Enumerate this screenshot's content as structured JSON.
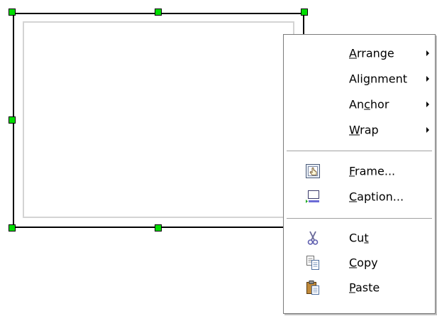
{
  "menu": {
    "items": [
      {
        "id": "arrange",
        "pre": "",
        "accel": "A",
        "post": "rrange",
        "submenu": true
      },
      {
        "id": "alignment",
        "pre": "Ali",
        "accel": "g",
        "post": "nment",
        "submenu": true
      },
      {
        "id": "anchor",
        "pre": "An",
        "accel": "c",
        "post": "hor",
        "submenu": true
      },
      {
        "id": "wrap",
        "pre": "",
        "accel": "W",
        "post": "rap",
        "submenu": true
      },
      {
        "id": "frame",
        "pre": "",
        "accel": "F",
        "post": "rame...",
        "submenu": false,
        "icon": "frame-properties-icon"
      },
      {
        "id": "caption",
        "pre": "",
        "accel": "C",
        "post": "aption...",
        "submenu": false,
        "icon": "caption-icon"
      },
      {
        "id": "cut",
        "pre": "Cu",
        "accel": "t",
        "post": "",
        "submenu": false,
        "icon": "scissors-icon"
      },
      {
        "id": "copy",
        "pre": "",
        "accel": "C",
        "post": "opy",
        "submenu": false,
        "icon": "copy-icon"
      },
      {
        "id": "paste",
        "pre": "",
        "accel": "P",
        "post": "aste",
        "submenu": false,
        "icon": "paste-icon"
      }
    ]
  },
  "colors": {
    "handle": "#00dd00",
    "frame_border": "#000000",
    "menu_border": "#7a7a7a"
  }
}
